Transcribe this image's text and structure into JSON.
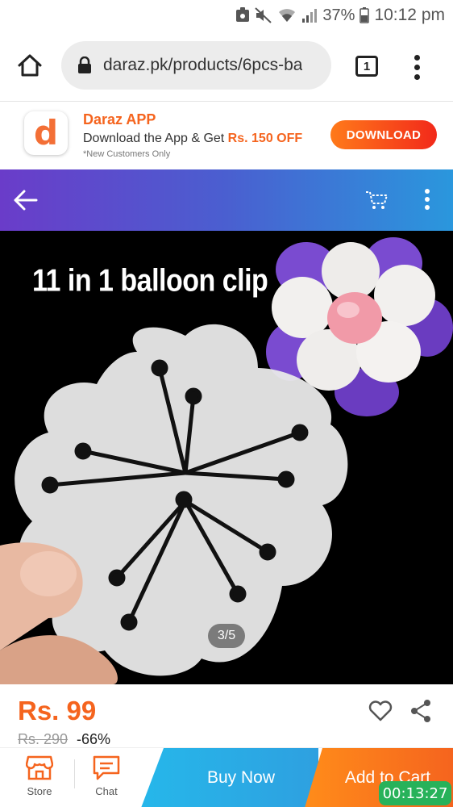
{
  "status_bar": {
    "battery": "37%",
    "time": "10:12 pm",
    "icons": [
      "notification-icon",
      "mute-icon",
      "wifi-icon",
      "signal-icon",
      "battery-icon"
    ]
  },
  "browser": {
    "url": "daraz.pk/products/6pcs-ba",
    "tab_count": "1",
    "icons": [
      "home-icon",
      "lock-icon",
      "tabs-icon",
      "menu-icon"
    ]
  },
  "app_banner": {
    "logo_letter": "d",
    "title": "Daraz APP",
    "desc_prefix": "Download the App & Get ",
    "desc_highlight": "Rs. 150 OFF",
    "note": "*New Customers Only",
    "button_label": "DOWNLOAD"
  },
  "header": {
    "icons": [
      "back-arrow-icon",
      "cart-icon",
      "more-icon"
    ]
  },
  "product_image": {
    "caption": "11 in 1 balloon clip",
    "counter": "3/5"
  },
  "pricing": {
    "price": "Rs. 99",
    "original_price": "Rs. 290",
    "discount": "-66%"
  },
  "bottom_bar": {
    "store_label": "Store",
    "chat_label": "Chat",
    "buy_now_label": "Buy Now",
    "add_to_cart_label": "Add to Cart"
  },
  "overlay": {
    "timer": "00:13:27"
  },
  "colors": {
    "accent_orange": "#f5641e",
    "header_purple": "#6a3cc9",
    "header_blue": "#2a97dd",
    "buy_now_blue": "#26b7ea",
    "timer_green": "#27b25a"
  }
}
